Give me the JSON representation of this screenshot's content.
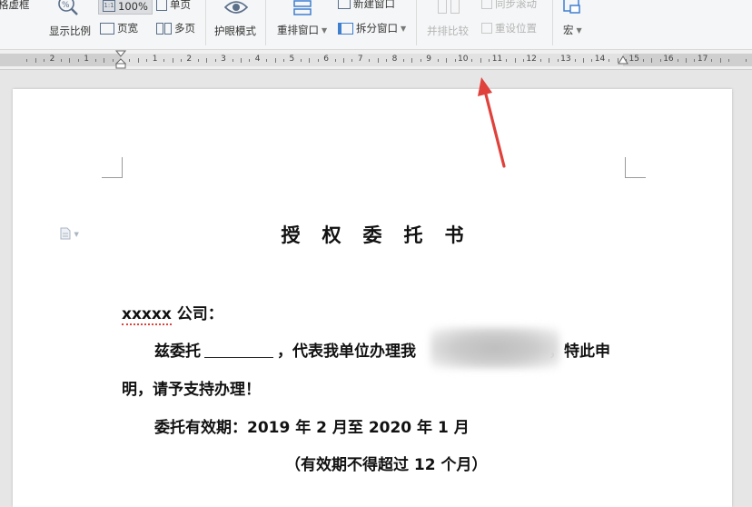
{
  "ribbon": {
    "frame_label": "格虚框",
    "zoom_label": "显示比例",
    "zoom_value": "100%",
    "single_page": "单页",
    "page_width": "页宽",
    "multi_page": "多页",
    "eye_mode": "护眼模式",
    "rearrange_window": "重排窗口",
    "new_window": "新建窗口",
    "split_window": "拆分窗口",
    "side_by_side": "并排比较",
    "sync_scroll": "同步滚动",
    "reset_position": "重设位置",
    "macro": "宏"
  },
  "ruler": {
    "numbers": [
      "2",
      "1",
      "1",
      "2",
      "3",
      "4",
      "5",
      "6",
      "7",
      "8",
      "9",
      "10",
      "11",
      "12",
      "13",
      "14",
      "15",
      "16",
      "17"
    ]
  },
  "document": {
    "title": "授权委托书",
    "addressee_name": "xxxxx",
    "addressee_suffix": " 公司：",
    "para1_start": "兹委托",
    "para1_mid": "，代表我单位办理我",
    "para1_end": "，特此申",
    "para1_wrap": "明，请予支持办理！",
    "validity": "委托有效期：2019 年 2 月至 2020 年 1 月",
    "validity_note": "（有效期不得超过 12 个月）"
  },
  "colors": {
    "arrow": "#e0413b",
    "ribbon_bg": "#f5f6f7",
    "page_bg": "#ffffff",
    "workspace_bg": "#e6e6e6"
  }
}
